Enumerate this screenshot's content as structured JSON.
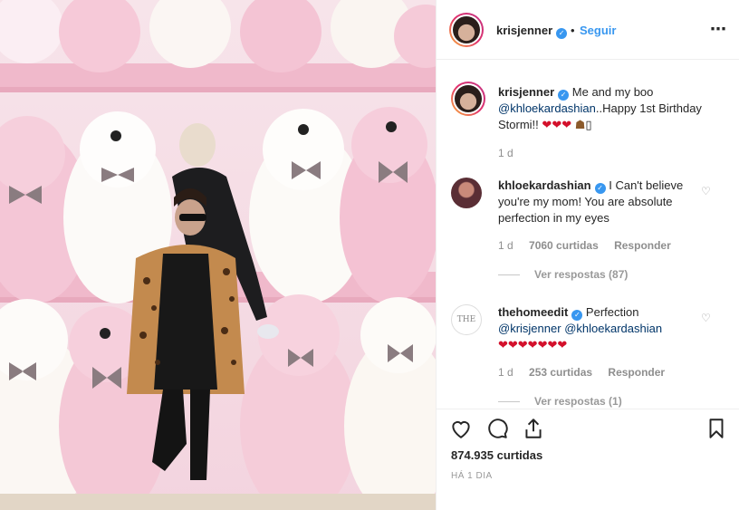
{
  "post": {
    "username": "krisjenner",
    "follow_label": "Seguir",
    "separator": "•",
    "more_icon": "⋯",
    "verified_glyph": "✓"
  },
  "caption": {
    "username": "krisjenner",
    "text_start": "Me and my boo",
    "mention": "@khloekardashian",
    "text_end": "..Happy 1st Birthday Stormi!!",
    "emojis": "❤❤❤",
    "cake": "☗",
    "trailing_box": "▯",
    "time": "1 d"
  },
  "comments": [
    {
      "username": "khloekardashian",
      "text": "I Can't believe you're my mom! You are absolute perfection in my eyes",
      "time": "1 d",
      "likes": "7060 curtidas",
      "reply_label": "Responder",
      "view_replies": "Ver respostas (87)"
    },
    {
      "username": "thehomeedit",
      "text": "Perfection",
      "mention1": "@krisjenner",
      "mention2": "@khloekardashian",
      "hearts": "❤❤❤❤❤❤❤",
      "time": "1 d",
      "likes": "253 curtidas",
      "reply_label": "Responder",
      "view_replies": "Ver respostas (1)",
      "avatar_text": "THE"
    }
  ],
  "footer": {
    "likes_total": "874.935 curtidas",
    "time_ago": "HÁ 1 DIA"
  },
  "icons": {
    "like": "heart-outline-icon",
    "comment": "speech-bubble-icon",
    "share": "share-icon",
    "save": "bookmark-icon",
    "comment_like": "♡"
  },
  "colors": {
    "link": "#3897f0",
    "mention": "#003569",
    "muted": "#8e8e8e",
    "heart_red": "#d3102b"
  }
}
